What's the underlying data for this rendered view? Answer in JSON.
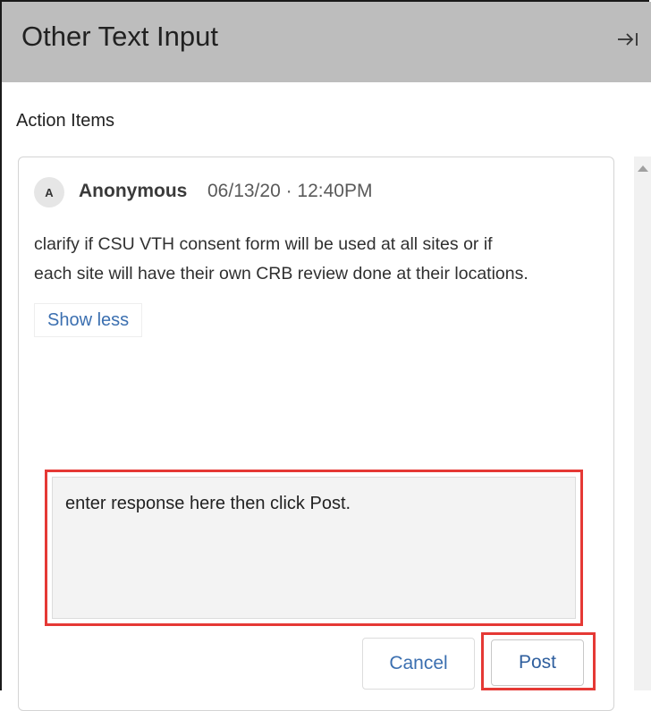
{
  "panel": {
    "title": "Other Text Input",
    "collapse_icon": "collapse-right-icon"
  },
  "section": {
    "label": "Action Items"
  },
  "comment": {
    "avatar_initial": "A",
    "author": "Anonymous",
    "timestamp": "06/13/20 · 12:40PM",
    "body_lines": [
      "clarify if CSU VTH consent form will be used at all sites or if",
      "each site will have their own CRB review done at their locations."
    ],
    "show_less_label": "Show less"
  },
  "response": {
    "value": "enter response here then click Post."
  },
  "actions": {
    "cancel_label": "Cancel",
    "post_label": "Post"
  },
  "colors": {
    "header_bg": "#bdbdbd",
    "link_blue": "#3b6fb0",
    "highlight_red": "#e53935",
    "input_bg": "#f3f3f3"
  }
}
